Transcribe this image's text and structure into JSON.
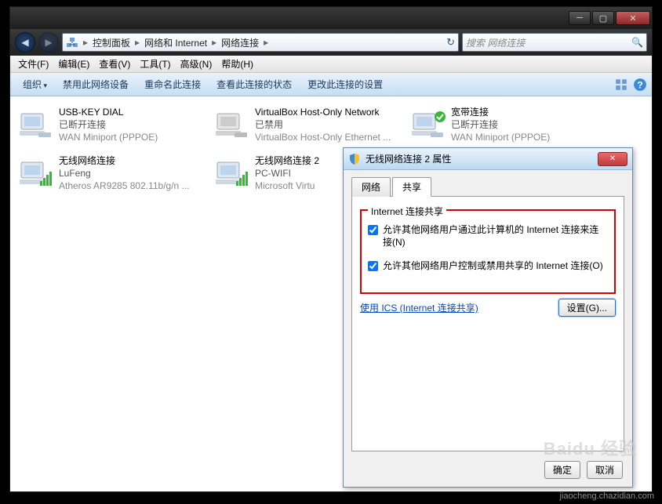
{
  "window": {
    "breadcrumb": [
      "控制面板",
      "网络和 Internet",
      "网络连接"
    ],
    "search_placeholder": "搜索 网络连接"
  },
  "menubar": [
    "文件(F)",
    "编辑(E)",
    "查看(V)",
    "工具(T)",
    "高级(N)",
    "帮助(H)"
  ],
  "toolbar": {
    "organize": "组织",
    "items": [
      "禁用此网络设备",
      "重命名此连接",
      "查看此连接的状态",
      "更改此连接的设置"
    ]
  },
  "connections": [
    {
      "name": "USB-KEY DIAL",
      "status": "已断开连接",
      "device": "WAN Miniport (PPPOE)",
      "type": "modem"
    },
    {
      "name": "VirtualBox Host-Only Network",
      "status": "已禁用",
      "device": "VirtualBox Host-Only Ethernet ...",
      "type": "lan-disabled"
    },
    {
      "name": "宽带连接",
      "status": "已断开连接",
      "device": "WAN Miniport (PPPOE)",
      "type": "modem-ok"
    },
    {
      "name": "无线网络连接",
      "status": "LuFeng",
      "device": "Atheros AR9285 802.11b/g/n ...",
      "type": "wifi"
    },
    {
      "name": "无线网络连接 2",
      "status": "PC-WIFI",
      "device": "Microsoft Virtu",
      "type": "wifi"
    }
  ],
  "dialog": {
    "title": "无线网络连接 2 属性",
    "tab_network": "网络",
    "tab_share": "共享",
    "group_legend": "Internet 连接共享",
    "check1": "允许其他网络用户通过此计算机的 Internet 连接来连接(N)",
    "check2": "允许其他网络用户控制或禁用共享的 Internet 连接(O)",
    "link": "使用 ICS (Internet 连接共享)",
    "settings_btn": "设置(G)...",
    "ok": "确定",
    "cancel": "取消"
  },
  "watermark": {
    "brand": "Baidu 经验",
    "url": "jiaocheng.chazidian.com"
  }
}
